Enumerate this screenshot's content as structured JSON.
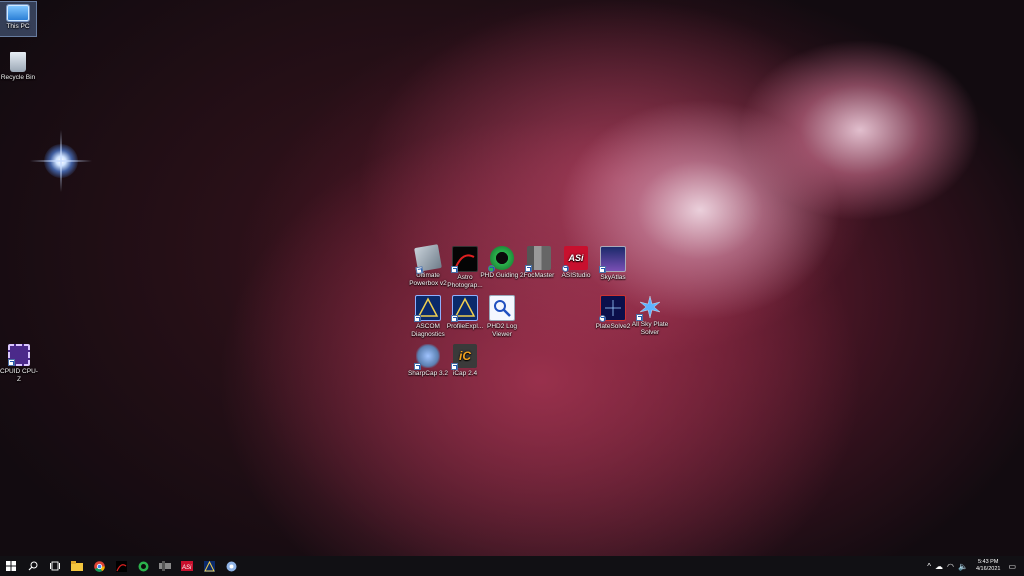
{
  "desktop": {
    "left_icons": [
      {
        "label": "This PC",
        "icon": "computer-icon"
      },
      {
        "label": "Recycle Bin",
        "icon": "recycle-bin-icon"
      },
      {
        "label": "CPUID CPU-Z",
        "icon": "cpu-z-icon"
      }
    ],
    "center_icons": [
      {
        "label": "Ultimate Powerbox v2",
        "icon": "powerbox-icon"
      },
      {
        "label": "Astro Photograp...",
        "icon": "astro-photography-tool-icon"
      },
      {
        "label": "PHD Guiding 2",
        "icon": "phd-guiding-icon"
      },
      {
        "label": "FocMaster",
        "icon": "focmaster-icon"
      },
      {
        "label": "ASIStudio",
        "icon": "asistudio-icon"
      },
      {
        "label": "SkyAtlas",
        "icon": "skyatlas-icon"
      },
      {
        "label": "ASCOM Diagnostics",
        "icon": "ascom-diagnostics-icon"
      },
      {
        "label": "ProfileExpl...",
        "icon": "profile-explorer-icon"
      },
      {
        "label": "PHD2 Log Viewer",
        "icon": "phd2-log-viewer-icon"
      },
      {
        "label": "PlateSolve2",
        "icon": "platesolve2-icon"
      },
      {
        "label": "All Sky Plate Solver",
        "icon": "all-sky-plate-solver-icon"
      },
      {
        "label": "SharpCap 3.2",
        "icon": "sharpcap-icon"
      },
      {
        "label": "iCap 2.4",
        "icon": "icap-icon"
      }
    ]
  },
  "taskbar": {
    "pinned": [
      "windows-start-icon",
      "search-icon",
      "task-view-icon",
      "file-explorer-icon",
      "chrome-icon",
      "astro-photography-tool-icon",
      "phd-guiding-icon",
      "focmaster-icon",
      "asistudio-icon",
      "profile-explorer-icon",
      "sharpcap-icon"
    ],
    "clock_time": "5:43 PM",
    "clock_date": "4/16/2021"
  },
  "colors": {
    "taskbar": "#111014",
    "nebula_core": "#b04a6a",
    "sky": "#120b10"
  }
}
